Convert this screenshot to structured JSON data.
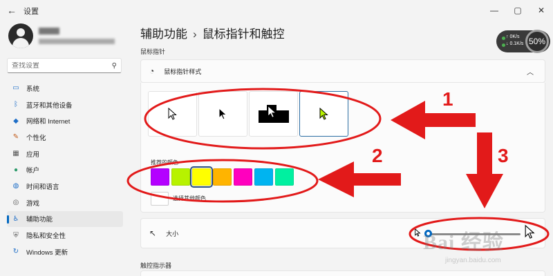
{
  "window": {
    "title": "设置",
    "back_glyph": "←",
    "minimize_glyph": "—",
    "maximize_glyph": "▢",
    "close_glyph": "✕"
  },
  "search": {
    "placeholder": "查找设置"
  },
  "sidebar": {
    "items": [
      {
        "label": "系统",
        "icon": "monitor-icon",
        "glyph": "▭",
        "color": "#1e6ec7"
      },
      {
        "label": "蓝牙和其他设备",
        "icon": "bluetooth-icon",
        "glyph": "ᛒ",
        "color": "#1e6ec7"
      },
      {
        "label": "网络和 Internet",
        "icon": "wifi-icon",
        "glyph": "◆",
        "color": "#1e6ec7"
      },
      {
        "label": "个性化",
        "icon": "brush-icon",
        "glyph": "✎",
        "color": "#c05a1a"
      },
      {
        "label": "应用",
        "icon": "apps-icon",
        "glyph": "▦",
        "color": "#555555"
      },
      {
        "label": "帐户",
        "icon": "account-icon",
        "glyph": "●",
        "color": "#2b9a6a"
      },
      {
        "label": "时间和语言",
        "icon": "globe-icon",
        "glyph": "◍",
        "color": "#1e6ec7"
      },
      {
        "label": "游戏",
        "icon": "gamepad-icon",
        "glyph": "◎",
        "color": "#555555"
      },
      {
        "label": "辅助功能",
        "icon": "accessibility-icon",
        "glyph": "♿",
        "color": "#1e6ec7",
        "active": true
      },
      {
        "label": "隐私和安全性",
        "icon": "shield-icon",
        "glyph": "⛨",
        "color": "#555555"
      },
      {
        "label": "Windows 更新",
        "icon": "update-icon",
        "glyph": "↻",
        "color": "#1e6ec7"
      }
    ]
  },
  "breadcrumb": {
    "parent": "辅助功能",
    "separator": "›",
    "current": "鼠标指针和触控"
  },
  "section_pointer": "鼠标指针",
  "pointer_style": {
    "title": "鼠标指针样式",
    "icon": "pointer-style-icon",
    "chevron": "︿",
    "selected_index": 3
  },
  "color_section": {
    "label": "推荐的颜色",
    "colors": [
      "#b400ff",
      "#b7f200",
      "#ffff00",
      "#ffb400",
      "#ff00be",
      "#00b4f0",
      "#00f0a0"
    ],
    "selected_index": 2,
    "custom_label": "选择其他颜色"
  },
  "size_setting": {
    "title": "大小",
    "value_fraction": 0.0
  },
  "section_touch": "触控指示器",
  "netwidget": {
    "up_rate": "0K/s",
    "down_rate": "0.1K/s",
    "percent": "50%"
  },
  "annotations": [
    "1",
    "2",
    "3"
  ],
  "accent_color": "#e21a1a",
  "watermark": {
    "brand": "Bai 经验",
    "url": "jingyan.baidu.com"
  }
}
